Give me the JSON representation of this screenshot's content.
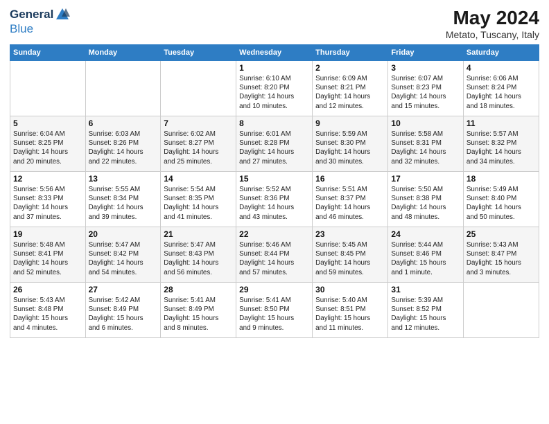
{
  "header": {
    "logo_general": "General",
    "logo_blue": "Blue",
    "title": "May 2024",
    "subtitle": "Metato, Tuscany, Italy"
  },
  "days_of_week": [
    "Sunday",
    "Monday",
    "Tuesday",
    "Wednesday",
    "Thursday",
    "Friday",
    "Saturday"
  ],
  "weeks": [
    [
      {
        "day": "",
        "info": ""
      },
      {
        "day": "",
        "info": ""
      },
      {
        "day": "",
        "info": ""
      },
      {
        "day": "1",
        "info": "Sunrise: 6:10 AM\nSunset: 8:20 PM\nDaylight: 14 hours\nand 10 minutes."
      },
      {
        "day": "2",
        "info": "Sunrise: 6:09 AM\nSunset: 8:21 PM\nDaylight: 14 hours\nand 12 minutes."
      },
      {
        "day": "3",
        "info": "Sunrise: 6:07 AM\nSunset: 8:23 PM\nDaylight: 14 hours\nand 15 minutes."
      },
      {
        "day": "4",
        "info": "Sunrise: 6:06 AM\nSunset: 8:24 PM\nDaylight: 14 hours\nand 18 minutes."
      }
    ],
    [
      {
        "day": "5",
        "info": "Sunrise: 6:04 AM\nSunset: 8:25 PM\nDaylight: 14 hours\nand 20 minutes."
      },
      {
        "day": "6",
        "info": "Sunrise: 6:03 AM\nSunset: 8:26 PM\nDaylight: 14 hours\nand 22 minutes."
      },
      {
        "day": "7",
        "info": "Sunrise: 6:02 AM\nSunset: 8:27 PM\nDaylight: 14 hours\nand 25 minutes."
      },
      {
        "day": "8",
        "info": "Sunrise: 6:01 AM\nSunset: 8:28 PM\nDaylight: 14 hours\nand 27 minutes."
      },
      {
        "day": "9",
        "info": "Sunrise: 5:59 AM\nSunset: 8:30 PM\nDaylight: 14 hours\nand 30 minutes."
      },
      {
        "day": "10",
        "info": "Sunrise: 5:58 AM\nSunset: 8:31 PM\nDaylight: 14 hours\nand 32 minutes."
      },
      {
        "day": "11",
        "info": "Sunrise: 5:57 AM\nSunset: 8:32 PM\nDaylight: 14 hours\nand 34 minutes."
      }
    ],
    [
      {
        "day": "12",
        "info": "Sunrise: 5:56 AM\nSunset: 8:33 PM\nDaylight: 14 hours\nand 37 minutes."
      },
      {
        "day": "13",
        "info": "Sunrise: 5:55 AM\nSunset: 8:34 PM\nDaylight: 14 hours\nand 39 minutes."
      },
      {
        "day": "14",
        "info": "Sunrise: 5:54 AM\nSunset: 8:35 PM\nDaylight: 14 hours\nand 41 minutes."
      },
      {
        "day": "15",
        "info": "Sunrise: 5:52 AM\nSunset: 8:36 PM\nDaylight: 14 hours\nand 43 minutes."
      },
      {
        "day": "16",
        "info": "Sunrise: 5:51 AM\nSunset: 8:37 PM\nDaylight: 14 hours\nand 46 minutes."
      },
      {
        "day": "17",
        "info": "Sunrise: 5:50 AM\nSunset: 8:38 PM\nDaylight: 14 hours\nand 48 minutes."
      },
      {
        "day": "18",
        "info": "Sunrise: 5:49 AM\nSunset: 8:40 PM\nDaylight: 14 hours\nand 50 minutes."
      }
    ],
    [
      {
        "day": "19",
        "info": "Sunrise: 5:48 AM\nSunset: 8:41 PM\nDaylight: 14 hours\nand 52 minutes."
      },
      {
        "day": "20",
        "info": "Sunrise: 5:47 AM\nSunset: 8:42 PM\nDaylight: 14 hours\nand 54 minutes."
      },
      {
        "day": "21",
        "info": "Sunrise: 5:47 AM\nSunset: 8:43 PM\nDaylight: 14 hours\nand 56 minutes."
      },
      {
        "day": "22",
        "info": "Sunrise: 5:46 AM\nSunset: 8:44 PM\nDaylight: 14 hours\nand 57 minutes."
      },
      {
        "day": "23",
        "info": "Sunrise: 5:45 AM\nSunset: 8:45 PM\nDaylight: 14 hours\nand 59 minutes."
      },
      {
        "day": "24",
        "info": "Sunrise: 5:44 AM\nSunset: 8:46 PM\nDaylight: 15 hours\nand 1 minute."
      },
      {
        "day": "25",
        "info": "Sunrise: 5:43 AM\nSunset: 8:47 PM\nDaylight: 15 hours\nand 3 minutes."
      }
    ],
    [
      {
        "day": "26",
        "info": "Sunrise: 5:43 AM\nSunset: 8:48 PM\nDaylight: 15 hours\nand 4 minutes."
      },
      {
        "day": "27",
        "info": "Sunrise: 5:42 AM\nSunset: 8:49 PM\nDaylight: 15 hours\nand 6 minutes."
      },
      {
        "day": "28",
        "info": "Sunrise: 5:41 AM\nSunset: 8:49 PM\nDaylight: 15 hours\nand 8 minutes."
      },
      {
        "day": "29",
        "info": "Sunrise: 5:41 AM\nSunset: 8:50 PM\nDaylight: 15 hours\nand 9 minutes."
      },
      {
        "day": "30",
        "info": "Sunrise: 5:40 AM\nSunset: 8:51 PM\nDaylight: 15 hours\nand 11 minutes."
      },
      {
        "day": "31",
        "info": "Sunrise: 5:39 AM\nSunset: 8:52 PM\nDaylight: 15 hours\nand 12 minutes."
      },
      {
        "day": "",
        "info": ""
      }
    ]
  ]
}
